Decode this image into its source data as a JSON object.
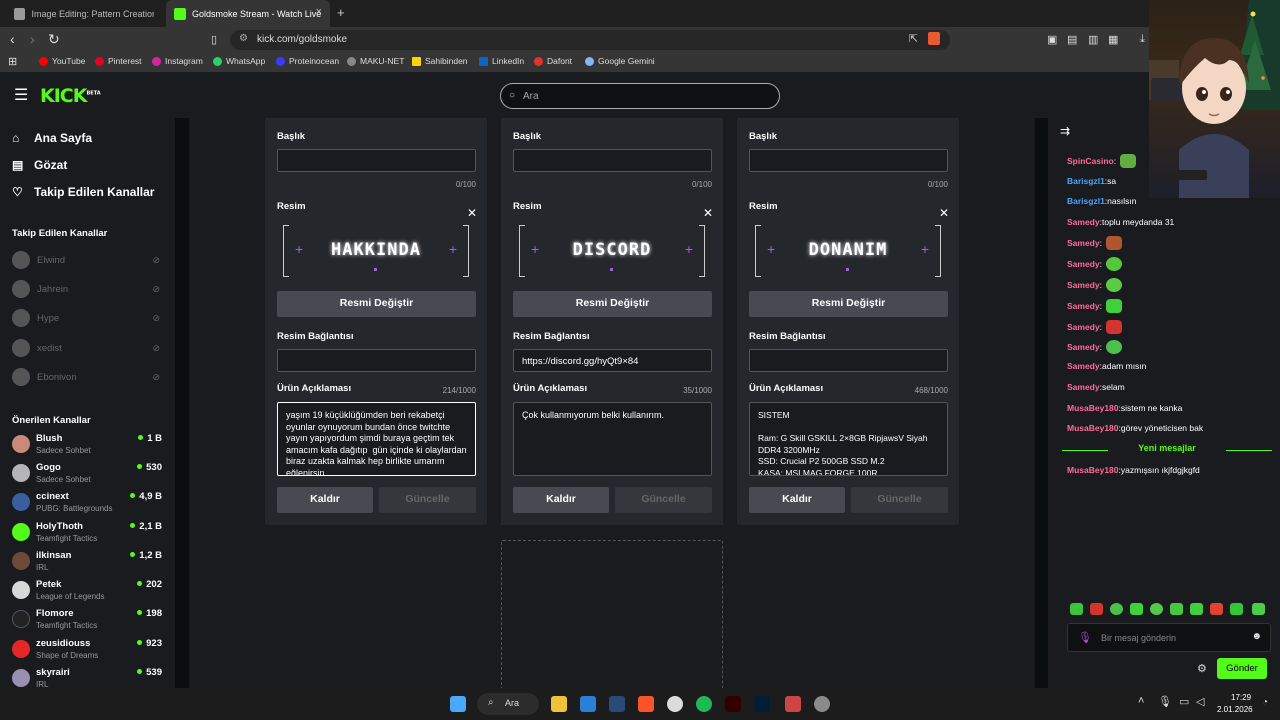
{
  "browser": {
    "tabs": [
      {
        "title": "Image Editing: Pattern Creation - Gro",
        "color": "#9a9a9a"
      },
      {
        "title": "Goldsmoke Stream - Watch Live",
        "color": "#53fc18"
      }
    ],
    "url": "kick.com/goldsmoke",
    "bookmarks": [
      {
        "label": "YouTube",
        "color": "#ff0000"
      },
      {
        "label": "Pinterest",
        "color": "#e60023"
      },
      {
        "label": "Instagram",
        "color": "#d6249f"
      },
      {
        "label": "WhatsApp",
        "color": "#25d366"
      },
      {
        "label": "Proteinocean",
        "color": "#3b3bff"
      },
      {
        "label": "MAKU-NET",
        "color": "#888888"
      },
      {
        "label": "Sahibinden",
        "color": "#ffd400"
      },
      {
        "label": "LinkedIn",
        "color": "#0a66c2"
      },
      {
        "label": "Dafont",
        "color": "#e5322d"
      },
      {
        "label": "Google Gemini",
        "color": "#8ab4f8"
      }
    ]
  },
  "kick": {
    "logo": "KICK",
    "beta": "BETA",
    "search_placeholder": "Ara"
  },
  "sidebar": {
    "nav": [
      {
        "label": "Ana Sayfa",
        "icon": "home-icon"
      },
      {
        "label": "Gözat",
        "icon": "browse-icon"
      },
      {
        "label": "Takip Edilen Kanallar",
        "icon": "heart-icon"
      }
    ],
    "followed_title": "Takip Edilen Kanallar",
    "followed": [
      {
        "name": "Elwind"
      },
      {
        "name": "Jahrein"
      },
      {
        "name": "Hype"
      },
      {
        "name": "xedist"
      },
      {
        "name": "Ebonivon"
      }
    ],
    "recommended_title": "Önerilen Kanallar",
    "recommended": [
      {
        "name": "Blush",
        "category": "Sadece Sohbet",
        "viewers": "1 B",
        "color": "#c98a7a"
      },
      {
        "name": "Gogo",
        "category": "Sadece Sohbet",
        "viewers": "530",
        "color": "#b5b5b5"
      },
      {
        "name": "ccinext",
        "category": "PUBG: Battlegrounds",
        "viewers": "4,9 B",
        "color": "#3a5fa0"
      },
      {
        "name": "HolyThoth",
        "category": "Teamfight Tactics",
        "viewers": "2,1 B",
        "color": "#53fc18"
      },
      {
        "name": "ilkinsan",
        "category": "IRL",
        "viewers": "1,2 B",
        "color": "#6b4a3a"
      },
      {
        "name": "Petek",
        "category": "League of Legends",
        "viewers": "202",
        "color": "#d8d8d8"
      },
      {
        "name": "Flomore",
        "category": "Teamfight Tactics",
        "viewers": "198",
        "color": "#222222"
      },
      {
        "name": "zeusidiouss",
        "category": "Shape of Dreams",
        "viewers": "923",
        "color": "#e62727"
      },
      {
        "name": "skyrairi",
        "category": "IRL",
        "viewers": "539",
        "color": "#9a8fb0"
      }
    ]
  },
  "panels": [
    {
      "title_label": "Başlık",
      "title_value": "",
      "title_count": "0/100",
      "image_label": "Resim",
      "image_text": "HAKKINDA",
      "change_button": "Resmi Değiştir",
      "link_label": "Resim Bağlantısı",
      "link_value": "",
      "desc_label": "Ürün Açıklaması",
      "desc_count": "214/1000",
      "desc_value": "yaşım 19 küçüklüğümden beri rekabetçi oyunlar oynuyorum bundan önce twitchte yayın yapıyordum şimdi buraya geçtim tek amacım kafa dağıtıp  gün içinde ki olaylardan biraz uzakta kalmak hep birlikte umarım eğlenirsin",
      "remove_button": "Kaldır",
      "update_button": "Güncelle"
    },
    {
      "title_label": "Başlık",
      "title_value": "",
      "title_count": "0/100",
      "image_label": "Resim",
      "image_text": "DISCORD",
      "change_button": "Resmi Değiştir",
      "link_label": "Resim Bağlantısı",
      "link_value": "https://discord.gg/hyQt9×84",
      "desc_label": "Ürün Açıklaması",
      "desc_count": "35/1000",
      "desc_value": "Çok kullanmıyorum belki kullanırım.",
      "remove_button": "Kaldır",
      "update_button": "Güncelle"
    },
    {
      "title_label": "Başlık",
      "title_value": "",
      "title_count": "0/100",
      "image_label": "Resim",
      "image_text": "DONANIM",
      "change_button": "Resmi Değiştir",
      "link_label": "Resim Bağlantısı",
      "link_value": "",
      "desc_label": "Ürün Açıklaması",
      "desc_count": "468/1000",
      "desc_value": "SISTEM\n\nRam: G Skill GSKILL 2×8GB RipjawsV Siyah DDR4 3200MHz\nSSD: Crucial P2 500GB SSD M.2\nKASA: MSI MAG FORGE 100R",
      "remove_button": "Kaldır",
      "update_button": "Güncelle"
    }
  ],
  "chat": {
    "messages": [
      {
        "user": "SpinCasino",
        "text": "",
        "color": "#ff6b9a",
        "emote": "#5fae3f"
      },
      {
        "user": "Barisgzl1",
        "text": "sa",
        "color": "#4aa3ff",
        "emote": ""
      },
      {
        "user": "Barisgzl1",
        "text": "nasılsın",
        "color": "#4aa3ff",
        "emote": ""
      },
      {
        "user": "Samedy",
        "text": "toplu meydanda 31",
        "color": "#ff6b9a",
        "emote": ""
      },
      {
        "user": "Samedy",
        "text": "",
        "color": "#ff6b9a",
        "emote": "#b0552d"
      },
      {
        "user": "Samedy",
        "text": "",
        "color": "#ff6b9a",
        "emote": "#53c93a"
      },
      {
        "user": "Samedy",
        "text": "",
        "color": "#ff6b9a",
        "emote": "#5acb45"
      },
      {
        "user": "Samedy",
        "text": "",
        "color": "#ff6b9a",
        "emote": "#3ed13a"
      },
      {
        "user": "Samedy",
        "text": "",
        "color": "#ff6b9a",
        "emote": "#d2352e"
      },
      {
        "user": "Samedy",
        "text": "",
        "color": "#ff6b9a",
        "emote": "#4cc04a"
      },
      {
        "user": "Samedy",
        "text": "adam mısın",
        "color": "#ff6b9a",
        "emote": ""
      },
      {
        "user": "Samedy",
        "text": "selam",
        "color": "#ff6b9a",
        "emote": ""
      },
      {
        "user": "MusaBey180",
        "text": "sistem ne kanka",
        "color": "#ff6b9a",
        "emote": ""
      },
      {
        "user": "MusaBey180",
        "text": "görev yöneticisen bak",
        "color": "#ff6b9a",
        "emote": ""
      }
    ],
    "new_label": "Yeni mesajlar",
    "after": [
      {
        "user": "MusaBey180",
        "text": "yazmışsın ıkjfdgjkgfd",
        "color": "#ff6b9a"
      }
    ],
    "emote_bar": [
      "#3cc43a",
      "#d2352e",
      "#4cc04a",
      "#3ed13a",
      "#56c94a",
      "#48c83c",
      "#3fcf3f",
      "#e2432f",
      "#34c634",
      "#4ace4a"
    ],
    "input_placeholder": "Bir mesaj gönderin",
    "send_label": "Gönder"
  },
  "taskbar": {
    "search": "Ara",
    "time": "17:29",
    "date": "2.01.2026"
  }
}
